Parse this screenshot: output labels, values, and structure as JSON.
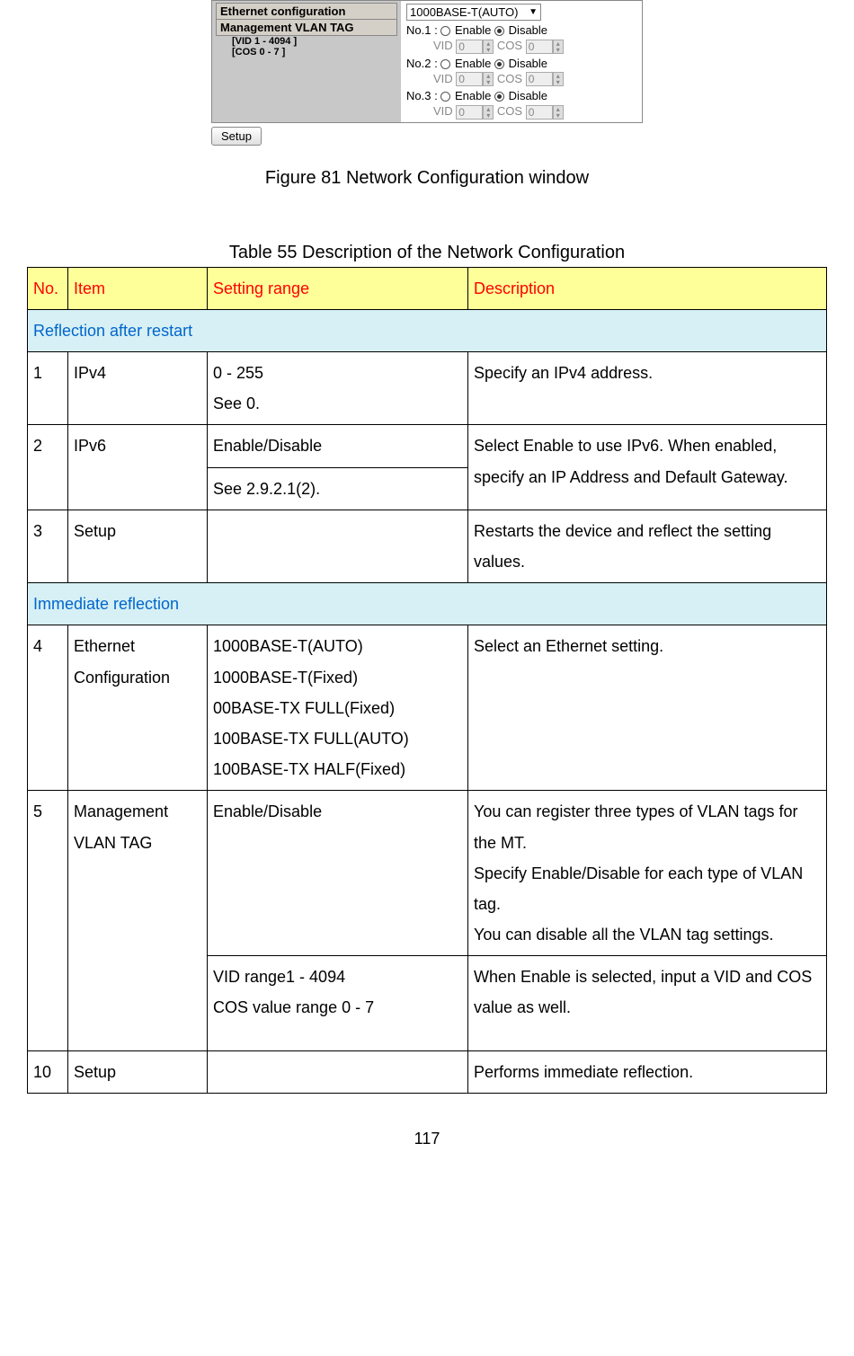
{
  "screenshot": {
    "left_header1": "Ethernet configuration",
    "left_header2": "Management VLAN TAG",
    "left_sub1": "[VID 1 - 4094 ]",
    "left_sub2": "[COS 0 - 7 ]",
    "select_value": "1000BASE-T(AUTO)",
    "rows": [
      {
        "label": "No.1 :",
        "enable": "Enable",
        "disable": "Disable",
        "vid_label": "VID",
        "vid_val": "0",
        "cos_label": "COS",
        "cos_val": "0"
      },
      {
        "label": "No.2 :",
        "enable": "Enable",
        "disable": "Disable",
        "vid_label": "VID",
        "vid_val": "0",
        "cos_label": "COS",
        "cos_val": "0"
      },
      {
        "label": "No.3 :",
        "enable": "Enable",
        "disable": "Disable",
        "vid_label": "VID",
        "vid_val": "0",
        "cos_label": "COS",
        "cos_val": "0"
      }
    ],
    "setup_btn": "Setup"
  },
  "fig_caption": "Figure 81 Network Configuration window",
  "tbl_caption": "Table 55 Description of the Network Configuration",
  "headers": {
    "no": "No.",
    "item": "Item",
    "range": "Setting range",
    "desc": "Description"
  },
  "section1": "Reflection after restart",
  "section2": "Immediate reflection",
  "rows": {
    "r1": {
      "no": "1",
      "item": "IPv4",
      "range": "0 - 255\nSee 0.",
      "desc": "Specify an IPv4 address."
    },
    "r2": {
      "no": "2",
      "item": "IPv6",
      "range_a": "Enable/Disable",
      "range_b": "See 2.9.2.1(2).",
      "desc": "Select Enable to use IPv6. When enabled, specify an IP Address and Default Gateway."
    },
    "r3": {
      "no": "3",
      "item": "Setup",
      "range": "",
      "desc": "Restarts the device and reflect the setting values."
    },
    "r4": {
      "no": "4",
      "item": "Ethernet Configuration",
      "range": "1000BASE-T(AUTO)\n1000BASE-T(Fixed)\n00BASE-TX FULL(Fixed)\n100BASE-TX FULL(AUTO)\n100BASE-TX HALF(Fixed)",
      "desc": "Select an Ethernet setting."
    },
    "r5": {
      "no": "5",
      "item": "Management VLAN TAG",
      "range_a": "Enable/Disable",
      "desc_a": "You can register three types of VLAN tags for the MT.\nSpecify Enable/Disable for each type of VLAN tag.\nYou can disable all the VLAN tag settings.",
      "range_b": "VID range1 - 4094\nCOS value range 0 - 7",
      "desc_b": "When Enable is selected, input a VID and COS value as well."
    },
    "r10": {
      "no": "10",
      "item": "Setup",
      "range": "",
      "desc": "Performs immediate reflection."
    }
  },
  "page_num": "117"
}
